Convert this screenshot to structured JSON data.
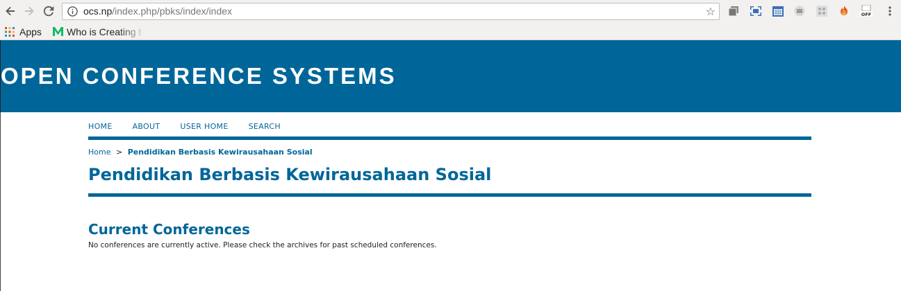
{
  "browser": {
    "url_host": "ocs.np",
    "url_path": "/index.php/pbks/index/index",
    "bookmarks": [
      {
        "label": "Apps"
      },
      {
        "label": "Who is Creating t"
      }
    ]
  },
  "site": {
    "banner_title": "OPEN CONFERENCE SYSTEMS",
    "nav": [
      {
        "label": "HOME"
      },
      {
        "label": "ABOUT"
      },
      {
        "label": "USER HOME"
      },
      {
        "label": "SEARCH"
      }
    ]
  },
  "breadcrumb": {
    "home": "Home",
    "separator": ">",
    "current": "Pendidikan Berbasis Kewirausahaan Sosial"
  },
  "page": {
    "title": "Pendidikan Berbasis Kewirausahaan Sosial",
    "section_title": "Current Conferences",
    "section_text": "No conferences are currently active. Please check the archives for past scheduled conferences."
  },
  "colors": {
    "brand": "#006699",
    "chrome": "#f2f1f0"
  }
}
